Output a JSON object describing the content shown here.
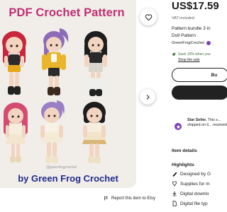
{
  "image": {
    "title": "PDF Crochet Pattern",
    "caption": "by Green Frog Crochet",
    "watermark": "@greenfrogcrochet"
  },
  "report_link": "Report this item to Etsy",
  "listing": {
    "price": "US$17.59",
    "vat": "VAT included",
    "title_lines": [
      "Pattern bundle 3 in",
      "Doll Pattern"
    ],
    "shop_name": "GreenFrogCrochet",
    "save_text": "Save 10% when you",
    "sale_link": "Shop the sale",
    "buy_label": "Bu"
  },
  "star_seller": {
    "heading": "Star Seller.",
    "body": "This s... shipped on ti... received."
  },
  "details": {
    "title": "Item details",
    "highlights_title": "Highlights",
    "highlights": [
      {
        "icon": "designer-icon",
        "label": "Designed by G"
      },
      {
        "icon": "supplies-icon",
        "label": "Supplies for m"
      },
      {
        "icon": "download-icon",
        "label": "Digital downlo"
      },
      {
        "icon": "file-icon",
        "label": "Digital file typ"
      }
    ]
  },
  "colors": {
    "title_pink": "#c02f72",
    "caption_blue": "#1f2a8a",
    "star_seller_purple": "#7b3fb8",
    "save_green": "#3c6e3c"
  }
}
